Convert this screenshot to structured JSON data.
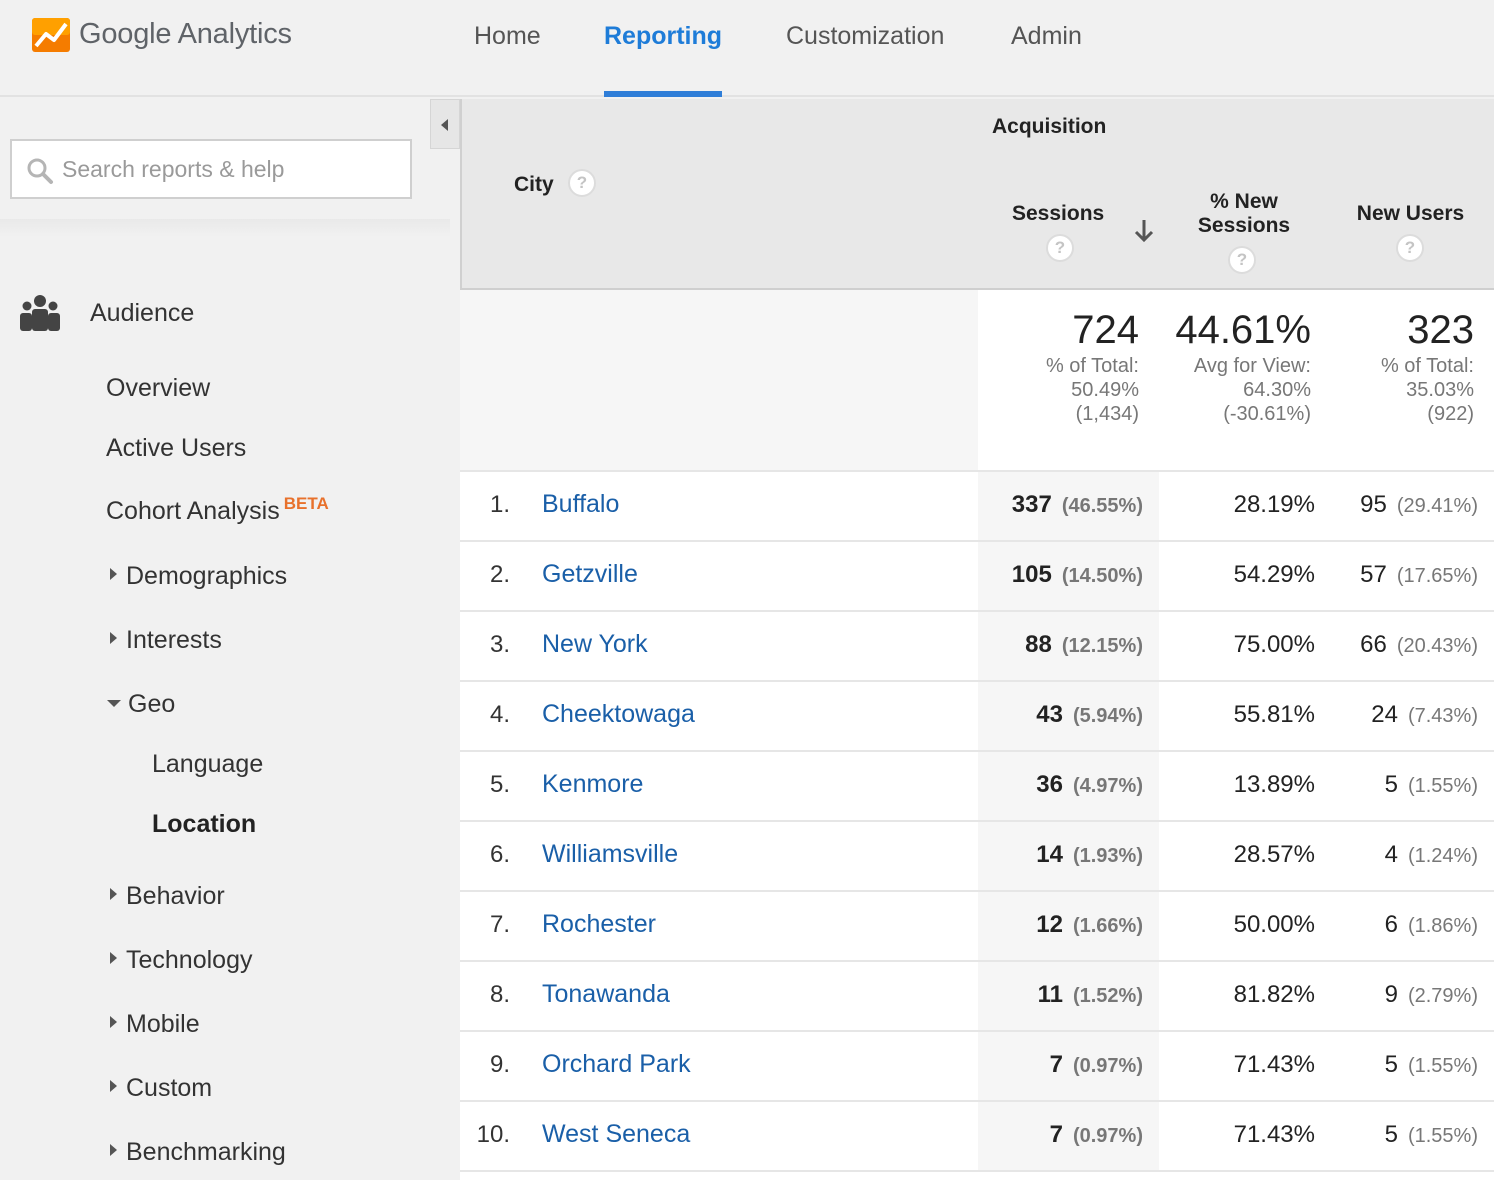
{
  "brand": "Google Analytics",
  "nav": [
    "Home",
    "Reporting",
    "Customization",
    "Admin"
  ],
  "search": {
    "placeholder": "Search reports & help"
  },
  "sidebar": {
    "section": "Audience",
    "items": [
      {
        "label": "Overview"
      },
      {
        "label": "Active Users"
      },
      {
        "label": "Cohort Analysis",
        "badge": "BETA"
      },
      {
        "label": "Demographics"
      },
      {
        "label": "Interests"
      },
      {
        "label": "Geo"
      },
      {
        "label": "Language"
      },
      {
        "label": "Location"
      },
      {
        "label": "Behavior"
      },
      {
        "label": "Technology"
      },
      {
        "label": "Mobile"
      },
      {
        "label": "Custom"
      },
      {
        "label": "Benchmarking"
      }
    ]
  },
  "table": {
    "dimension_header": "City",
    "group_header": "Acquisition",
    "columns": [
      "Sessions",
      "% New Sessions",
      "New Users"
    ],
    "col2_line1": "% New",
    "col2_line2": "Sessions",
    "totals": {
      "sessions": "724",
      "sessions_sub1": "% of Total:",
      "sessions_sub2": "50.49%",
      "sessions_sub3": "(1,434)",
      "new_sessions": "44.61%",
      "new_sessions_sub1": "Avg for View:",
      "new_sessions_sub2": "64.30%",
      "new_sessions_sub3": "(-30.61%)",
      "new_users": "323",
      "new_users_sub1": "% of Total:",
      "new_users_sub2": "35.03%",
      "new_users_sub3": "(922)"
    },
    "rows": [
      {
        "num": "1.",
        "city": "Buffalo",
        "sessions": "337",
        "sessions_pct": "(46.55%)",
        "new_sessions": "28.19%",
        "new_users": "95",
        "new_users_pct": "(29.41%)"
      },
      {
        "num": "2.",
        "city": "Getzville",
        "sessions": "105",
        "sessions_pct": "(14.50%)",
        "new_sessions": "54.29%",
        "new_users": "57",
        "new_users_pct": "(17.65%)"
      },
      {
        "num": "3.",
        "city": "New York",
        "sessions": "88",
        "sessions_pct": "(12.15%)",
        "new_sessions": "75.00%",
        "new_users": "66",
        "new_users_pct": "(20.43%)"
      },
      {
        "num": "4.",
        "city": "Cheektowaga",
        "sessions": "43",
        "sessions_pct": "(5.94%)",
        "new_sessions": "55.81%",
        "new_users": "24",
        "new_users_pct": "(7.43%)"
      },
      {
        "num": "5.",
        "city": "Kenmore",
        "sessions": "36",
        "sessions_pct": "(4.97%)",
        "new_sessions": "13.89%",
        "new_users": "5",
        "new_users_pct": "(1.55%)"
      },
      {
        "num": "6.",
        "city": "Williamsville",
        "sessions": "14",
        "sessions_pct": "(1.93%)",
        "new_sessions": "28.57%",
        "new_users": "4",
        "new_users_pct": "(1.24%)"
      },
      {
        "num": "7.",
        "city": "Rochester",
        "sessions": "12",
        "sessions_pct": "(1.66%)",
        "new_sessions": "50.00%",
        "new_users": "6",
        "new_users_pct": "(1.86%)"
      },
      {
        "num": "8.",
        "city": "Tonawanda",
        "sessions": "11",
        "sessions_pct": "(1.52%)",
        "new_sessions": "81.82%",
        "new_users": "9",
        "new_users_pct": "(2.79%)"
      },
      {
        "num": "9.",
        "city": "Orchard Park",
        "sessions": "7",
        "sessions_pct": "(0.97%)",
        "new_sessions": "71.43%",
        "new_users": "5",
        "new_users_pct": "(1.55%)"
      },
      {
        "num": "10.",
        "city": "West Seneca",
        "sessions": "7",
        "sessions_pct": "(0.97%)",
        "new_sessions": "71.43%",
        "new_users": "5",
        "new_users_pct": "(1.55%)"
      }
    ]
  },
  "colors": {
    "accent": "#2f7ed8",
    "link": "#1a5fa8",
    "beta": "#e8712c"
  }
}
